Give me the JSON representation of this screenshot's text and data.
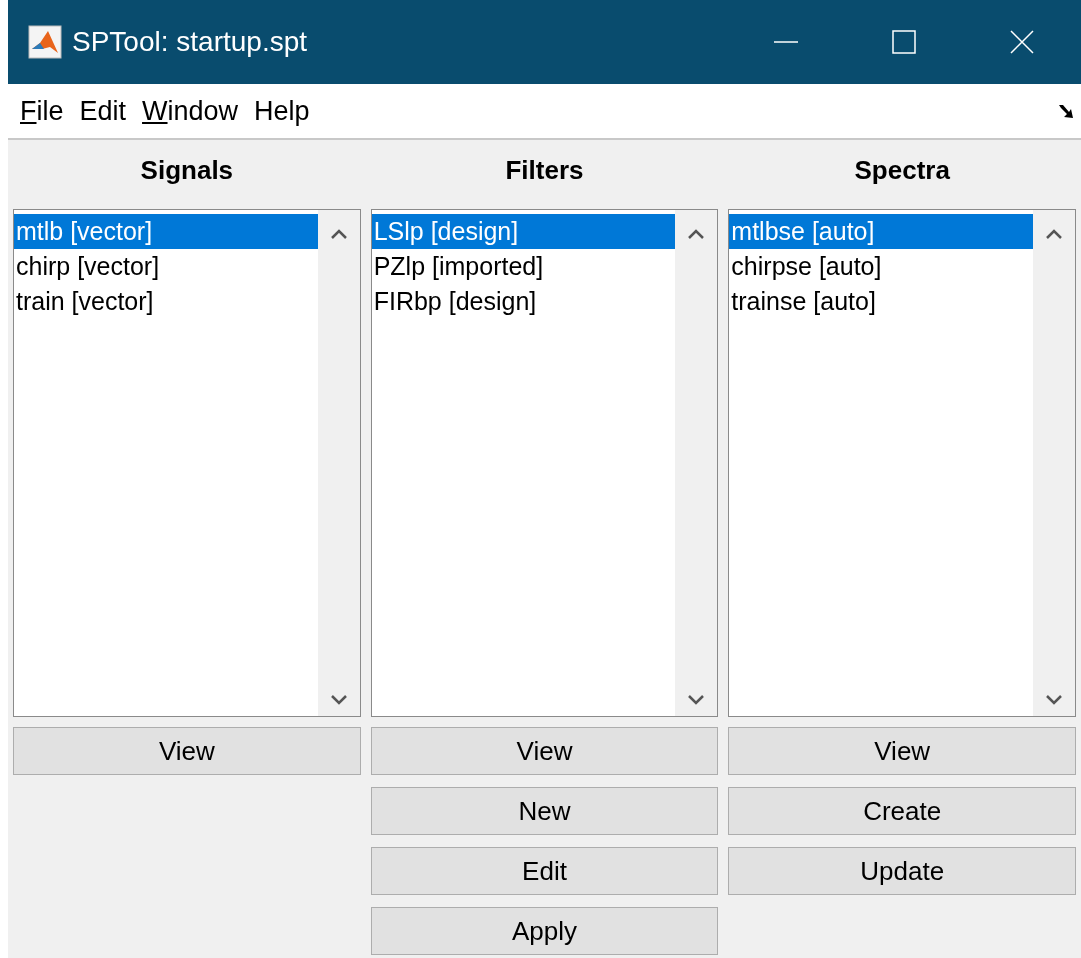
{
  "window": {
    "title": "SPTool: startup.spt"
  },
  "menu": [
    {
      "label": "File",
      "mnemonic": true
    },
    {
      "label": "Edit",
      "mnemonic": false
    },
    {
      "label": "Window",
      "mnemonic": true
    },
    {
      "label": "Help",
      "mnemonic": false
    }
  ],
  "panels": [
    {
      "title": "Signals",
      "items": [
        {
          "label": "mtlb [vector]",
          "selected": true
        },
        {
          "label": "chirp [vector]",
          "selected": false
        },
        {
          "label": "train [vector]",
          "selected": false
        }
      ],
      "buttons": [
        "View"
      ]
    },
    {
      "title": "Filters",
      "items": [
        {
          "label": "LSlp [design]",
          "selected": true
        },
        {
          "label": "PZlp [imported]",
          "selected": false
        },
        {
          "label": "FIRbp [design]",
          "selected": false
        }
      ],
      "buttons": [
        "View",
        "New",
        "Edit",
        "Apply"
      ]
    },
    {
      "title": "Spectra",
      "items": [
        {
          "label": "mtlbse [auto]",
          "selected": true
        },
        {
          "label": "chirpse [auto]",
          "selected": false
        },
        {
          "label": "trainse [auto]",
          "selected": false
        }
      ],
      "buttons": [
        "View",
        "Create",
        "Update"
      ]
    }
  ]
}
